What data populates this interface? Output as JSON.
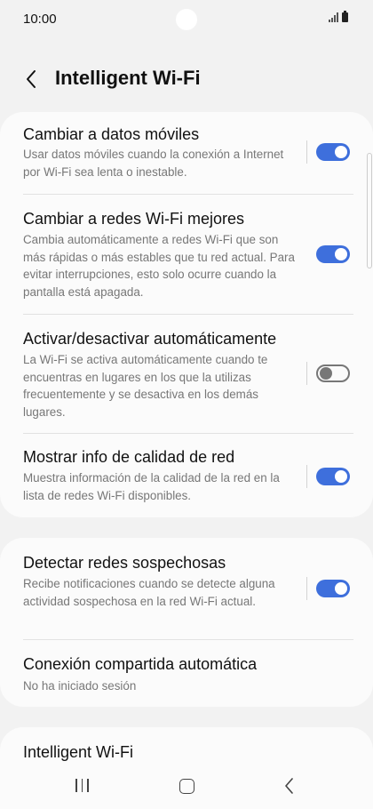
{
  "status_bar": {
    "time": "10:00"
  },
  "header": {
    "title": "Intelligent Wi-Fi"
  },
  "group1": [
    {
      "title": "Cambiar a datos móviles",
      "description": "Usar datos móviles cuando la conexión a Internet por Wi-Fi sea lenta o inestable.",
      "enabled": true
    },
    {
      "title": "Cambiar a redes Wi-Fi mejores",
      "description": "Cambia automáticamente a redes Wi-Fi que son más rápidas o más estables que tu red actual. Para evitar interrupciones, esto solo ocurre cuando la pantalla está apagada.",
      "enabled": true
    },
    {
      "title": "Activar/desactivar automáticamente",
      "description": "La Wi-Fi se activa automáticamente cuando te encuentras en lugares en los que la utilizas frecuentemente y se desactiva en los demás lugares.",
      "enabled": false
    },
    {
      "title": "Mostrar info de calidad de red",
      "description": "Muestra información de la calidad de la red en la lista de redes Wi-Fi disponibles.",
      "enabled": true
    }
  ],
  "group2": [
    {
      "title": "Detectar redes sospechosas",
      "description": "Recibe notificaciones cuando se detecte alguna actividad sospechosa en la red Wi-Fi actual.",
      "enabled": true
    },
    {
      "title": "Conexión compartida automática",
      "description": "No ha iniciado sesión"
    }
  ],
  "group3": {
    "title": "Intelligent Wi-Fi"
  },
  "icons": {
    "back": "chevron-left-icon",
    "nav_recents": "recents-icon",
    "nav_home": "home-icon",
    "nav_back": "back-icon"
  },
  "colors": {
    "accent": "#3e6fdc",
    "background": "#f2f2f2",
    "card": "#fbfbfb"
  }
}
